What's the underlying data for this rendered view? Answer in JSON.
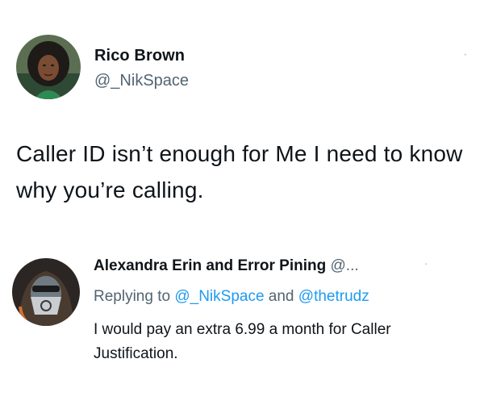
{
  "main_tweet": {
    "display_name": "Rico Brown",
    "handle": "@_NikSpace",
    "more_icon_glyph": "·",
    "text": "Caller ID isn’t enough for Me I need to know why you’re calling."
  },
  "reply": {
    "display_name": "Alexandra Erin and Error Pining",
    "handle": "@...",
    "more_icon_glyph": "·",
    "replying_prefix": "Replying to",
    "mention_1": "@_NikSpace",
    "conjunction": "and",
    "mention_2": "@thetrudz",
    "text": "I would pay an extra 6.99 a month for Caller Justification."
  },
  "colors": {
    "text": "#0f1419",
    "secondary": "#536471",
    "link": "#1d9bf0"
  }
}
